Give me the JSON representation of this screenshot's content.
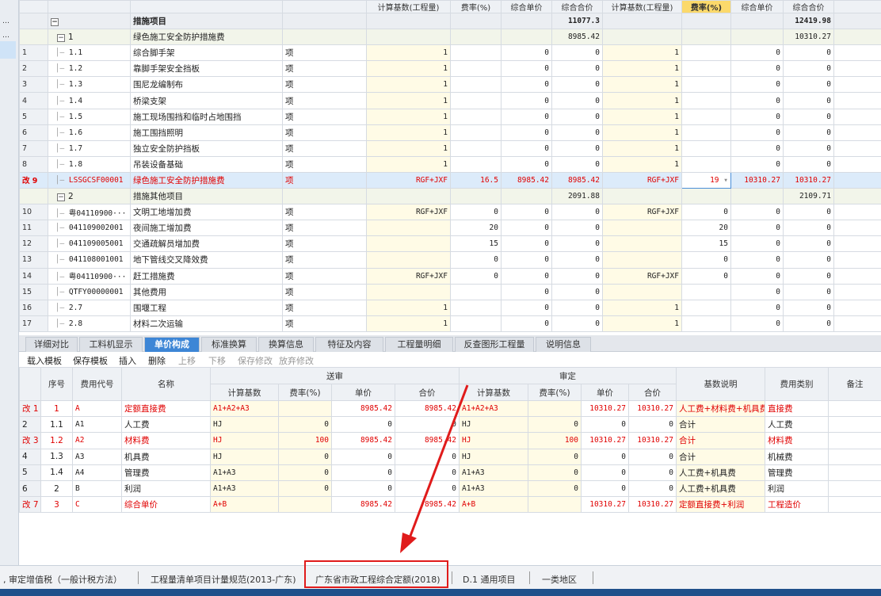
{
  "columns": {
    "c1": "计算基数(工程量)",
    "c2": "费率(%)",
    "c3": "综合单价",
    "c4": "综合合价",
    "c5": "计算基数(工程量)",
    "c6": "费率(%)",
    "c7": "综合单价",
    "c8": "综合合价"
  },
  "rows": [
    {
      "type": "grp0",
      "rn": "",
      "expand": "−",
      "code": "",
      "name": "措施项目",
      "unit": "",
      "b1": "",
      "r1": "",
      "p1": "",
      "t1": "11077.3",
      "b2": "",
      "r2": "",
      "p2": "",
      "t2": "12419.98"
    },
    {
      "type": "grp",
      "rn": "",
      "expand": "−",
      "code": "1",
      "name": "绿色施工安全防护措施费",
      "unit": "",
      "b1": "",
      "r1": "",
      "p1": "",
      "t1": "8985.42",
      "b2": "",
      "r2": "",
      "p2": "",
      "t2": "10310.27"
    },
    {
      "type": "row",
      "rn": "1",
      "code": "1.1",
      "name": "综合脚手架",
      "unit": "项",
      "b1": "1",
      "r1": "",
      "p1": "0",
      "t1": "0",
      "b2": "1",
      "r2": "",
      "p2": "0",
      "t2": "0"
    },
    {
      "type": "row",
      "rn": "2",
      "code": "1.2",
      "name": "靠脚手架安全挡板",
      "unit": "项",
      "b1": "1",
      "r1": "",
      "p1": "0",
      "t1": "0",
      "b2": "1",
      "r2": "",
      "p2": "0",
      "t2": "0"
    },
    {
      "type": "row",
      "rn": "3",
      "code": "1.3",
      "name": "围尼龙编制布",
      "unit": "项",
      "b1": "1",
      "r1": "",
      "p1": "0",
      "t1": "0",
      "b2": "1",
      "r2": "",
      "p2": "0",
      "t2": "0"
    },
    {
      "type": "row",
      "rn": "4",
      "code": "1.4",
      "name": "桥梁支架",
      "unit": "项",
      "b1": "1",
      "r1": "",
      "p1": "0",
      "t1": "0",
      "b2": "1",
      "r2": "",
      "p2": "0",
      "t2": "0"
    },
    {
      "type": "row",
      "rn": "5",
      "code": "1.5",
      "name": "施工现场围挡和临时占地围挡",
      "unit": "项",
      "b1": "1",
      "r1": "",
      "p1": "0",
      "t1": "0",
      "b2": "1",
      "r2": "",
      "p2": "0",
      "t2": "0"
    },
    {
      "type": "row",
      "rn": "6",
      "code": "1.6",
      "name": "施工围挡照明",
      "unit": "项",
      "b1": "1",
      "r1": "",
      "p1": "0",
      "t1": "0",
      "b2": "1",
      "r2": "",
      "p2": "0",
      "t2": "0"
    },
    {
      "type": "row",
      "rn": "7",
      "code": "1.7",
      "name": "独立安全防护挡板",
      "unit": "项",
      "b1": "1",
      "r1": "",
      "p1": "0",
      "t1": "0",
      "b2": "1",
      "r2": "",
      "p2": "0",
      "t2": "0"
    },
    {
      "type": "row",
      "rn": "8",
      "code": "1.8",
      "name": "吊装设备基础",
      "unit": "项",
      "b1": "1",
      "r1": "",
      "p1": "0",
      "t1": "0",
      "b2": "1",
      "r2": "",
      "p2": "0",
      "t2": "0"
    },
    {
      "type": "sel",
      "rn": "改 9",
      "code": "LSSGCSF00001",
      "name": "绿色施工安全防护措施费",
      "unit": "项",
      "b1": "RGF+JXF",
      "r1": "16.5",
      "p1": "8985.42",
      "t1": "8985.42",
      "b2": "RGF+JXF",
      "r2": "19",
      "p2": "10310.27",
      "t2": "10310.27"
    },
    {
      "type": "grp",
      "rn": "",
      "expand": "−",
      "code": "2",
      "name": "措施其他项目",
      "unit": "",
      "b1": "",
      "r1": "",
      "p1": "",
      "t1": "2091.88",
      "b2": "",
      "r2": "",
      "p2": "",
      "t2": "2109.71"
    },
    {
      "type": "row",
      "rn": "10",
      "code": "粤04110900···",
      "name": "文明工地增加费",
      "unit": "项",
      "b1": "RGF+JXF",
      "r1": "0",
      "p1": "0",
      "t1": "0",
      "b2": "RGF+JXF",
      "r2": "0",
      "p2": "0",
      "t2": "0"
    },
    {
      "type": "row",
      "rn": "11",
      "code": "041109002001",
      "name": "夜间施工增加费",
      "unit": "项",
      "b1": "",
      "r1": "20",
      "p1": "0",
      "t1": "0",
      "b2": "",
      "r2": "20",
      "p2": "0",
      "t2": "0"
    },
    {
      "type": "row",
      "rn": "12",
      "code": "041109005001",
      "name": "交通疏解员增加费",
      "unit": "项",
      "b1": "",
      "r1": "15",
      "p1": "0",
      "t1": "0",
      "b2": "",
      "r2": "15",
      "p2": "0",
      "t2": "0"
    },
    {
      "type": "row",
      "rn": "13",
      "code": "041108001001",
      "name": "地下管线交叉降效费",
      "unit": "项",
      "b1": "",
      "r1": "0",
      "p1": "0",
      "t1": "0",
      "b2": "",
      "r2": "0",
      "p2": "0",
      "t2": "0"
    },
    {
      "type": "row",
      "rn": "14",
      "code": "粤04110900···",
      "name": "赶工措施费",
      "unit": "项",
      "b1": "RGF+JXF",
      "r1": "0",
      "p1": "0",
      "t1": "0",
      "b2": "RGF+JXF",
      "r2": "0",
      "p2": "0",
      "t2": "0"
    },
    {
      "type": "row",
      "rn": "15",
      "code": "QTFY00000001",
      "name": "其他费用",
      "unit": "项",
      "b1": "",
      "r1": "",
      "p1": "0",
      "t1": "0",
      "b2": "",
      "r2": "",
      "p2": "0",
      "t2": "0"
    },
    {
      "type": "row",
      "rn": "16",
      "code": "2.7",
      "name": "围堰工程",
      "unit": "项",
      "b1": "1",
      "r1": "",
      "p1": "0",
      "t1": "0",
      "b2": "1",
      "r2": "",
      "p2": "0",
      "t2": "0"
    },
    {
      "type": "row",
      "rn": "17",
      "code": "2.8",
      "name": "材料二次运输",
      "unit": "项",
      "b1": "1",
      "r1": "",
      "p1": "0",
      "t1": "0",
      "b2": "1",
      "r2": "",
      "p2": "0",
      "t2": "0"
    }
  ],
  "tabs": [
    "详细对比",
    "工料机显示",
    "单价构成",
    "标准换算",
    "换算信息",
    "特征及内容",
    "工程量明细",
    "反查图形工程量",
    "说明信息"
  ],
  "active_tab": "单价构成",
  "toolbar": {
    "load": "载入模板",
    "save": "保存模板",
    "insert": "插入",
    "delete": "删除",
    "up": "上移",
    "down": "下移",
    "save_edit": "保存修改",
    "discard": "放弃修改"
  },
  "lower": {
    "h_seq": "序号",
    "h_code": "费用代号",
    "h_name": "名称",
    "h_send": "送审",
    "h_audit": "审定",
    "h_base": "计算基数",
    "h_rate": "费率(%)",
    "h_price": "单价",
    "h_total": "合价",
    "h_desc": "基数说明",
    "h_cat": "费用类别",
    "h_note": "备注",
    "rows": [
      {
        "red": true,
        "rn": "改 1",
        "seq": "1",
        "code": "A",
        "name": "定额直接费",
        "b1": "A1+A2+A3",
        "r1": "",
        "p1": "8985.42",
        "t1": "8985.42",
        "b2": "A1+A2+A3",
        "r2": "",
        "p2": "10310.27",
        "t2": "10310.27",
        "desc": "人工费+材料费+机具费",
        "cat": "直接费"
      },
      {
        "red": false,
        "rn": "2",
        "seq": "1.1",
        "code": "A1",
        "name": "人工费",
        "b1": "HJ",
        "r1": "0",
        "p1": "0",
        "t1": "0",
        "b2": "HJ",
        "r2": "0",
        "p2": "0",
        "t2": "0",
        "desc": "合计",
        "cat": "人工费"
      },
      {
        "red": true,
        "rn": "改 3",
        "seq": "1.2",
        "code": "A2",
        "name": "材料费",
        "b1": "HJ",
        "r1": "100",
        "p1": "8985.42",
        "t1": "8985.42",
        "b2": "HJ",
        "r2": "100",
        "p2": "10310.27",
        "t2": "10310.27",
        "desc": "合计",
        "cat": "材料费"
      },
      {
        "red": false,
        "rn": "4",
        "seq": "1.3",
        "code": "A3",
        "name": "机具费",
        "b1": "HJ",
        "r1": "0",
        "p1": "0",
        "t1": "0",
        "b2": "HJ",
        "r2": "0",
        "p2": "0",
        "t2": "0",
        "desc": "合计",
        "cat": "机械费"
      },
      {
        "red": false,
        "rn": "5",
        "seq": "1.4",
        "code": "A4",
        "name": "管理费",
        "b1": "A1+A3",
        "r1": "0",
        "p1": "0",
        "t1": "0",
        "b2": "A1+A3",
        "r2": "0",
        "p2": "0",
        "t2": "0",
        "desc": "人工费+机具费",
        "cat": "管理费"
      },
      {
        "red": false,
        "rn": "6",
        "seq": "2",
        "code": "B",
        "name": "利润",
        "b1": "A1+A3",
        "r1": "0",
        "p1": "0",
        "t1": "0",
        "b2": "A1+A3",
        "r2": "0",
        "p2": "0",
        "t2": "0",
        "desc": "人工费+机具费",
        "cat": "利润"
      },
      {
        "red": true,
        "rn": "改 7",
        "seq": "3",
        "code": "C",
        "name": "综合单价",
        "b1": "A+B",
        "r1": "",
        "p1": "8985.42",
        "t1": "8985.42",
        "b2": "A+B",
        "r2": "",
        "p2": "10310.27",
        "t2": "10310.27",
        "desc": "定额直接费+利润",
        "cat": "工程造价"
      }
    ]
  },
  "status": {
    "s1": ", 审定增值税（一般计税方法）",
    "s2": "工程量清单项目计量规范(2013-广东)",
    "s3": "广东省市政工程综合定额(2018)",
    "s4": "D.1 通用项目",
    "s5": "一类地区"
  },
  "annotation_color": "#e01b1b"
}
